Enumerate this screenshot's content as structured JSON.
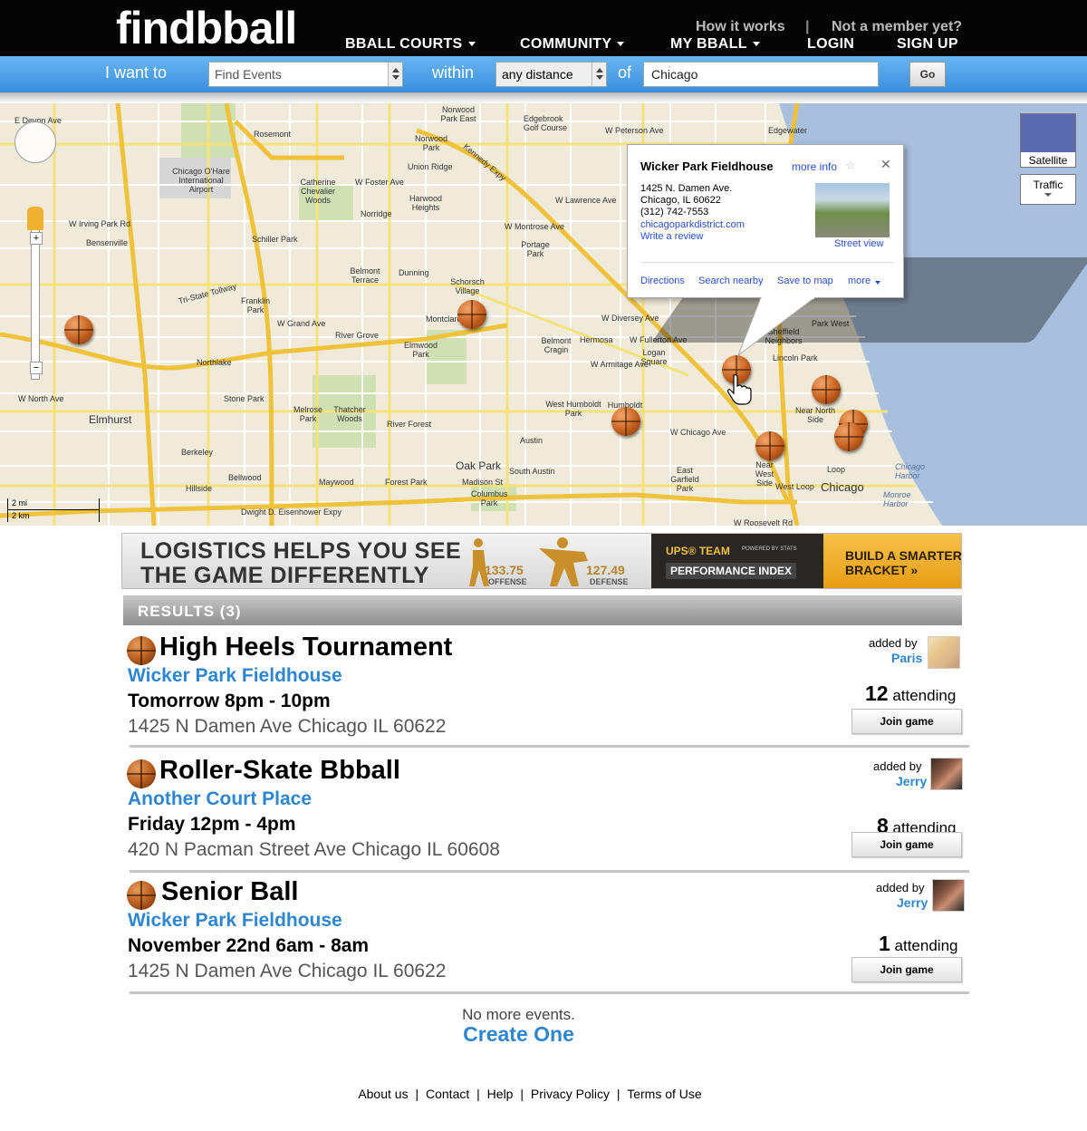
{
  "header": {
    "logo_text": "findbball",
    "how_it_works": "How it works",
    "separator": "|",
    "not_member": "Not a member yet?",
    "nav": [
      {
        "label": "BBALL COURTS"
      },
      {
        "label": "COMMUNITY"
      },
      {
        "label": "MY BBALL"
      }
    ],
    "login": "LOGIN",
    "signup": "SIGN UP"
  },
  "search": {
    "i_want_to": "I want to",
    "action_value": "Find Events",
    "within": "within",
    "distance_value": "any distance",
    "of": "of",
    "location_value": "Chicago",
    "go_label": "Go"
  },
  "map": {
    "maptype": {
      "satellite": "Satellite",
      "traffic": "Traffic"
    },
    "scale": {
      "mi": "2 mi",
      "km": "2 km"
    },
    "labels": [
      "E Devon Ave",
      "Rosemont",
      "Norridge",
      "Harwood Heights",
      "Norwood Park East",
      "Norwood Park",
      "Edgebrook Golf Course",
      "W Peterson Ave",
      "Edgewater",
      "Union Ridge",
      "Chicago O'Hare International Airport",
      "Schiller Park",
      "Bensenville",
      "Franklin Park",
      "Belmont Terrace",
      "Dunning",
      "Schorsch Village",
      "Montclare",
      "Portage Park",
      "Elmwood Park",
      "River Grove",
      "Belmont Cragin",
      "Hermosa",
      "Logan Square",
      "Sheffield Neighbors",
      "Lincoln Park",
      "Park West",
      "Northlake",
      "Stone Park",
      "Melrose Park",
      "Elmhurst",
      "Humboldt Park",
      "West Humboldt Park",
      "River Forest",
      "Oak Park",
      "Austin",
      "Near North Side",
      "Berkeley",
      "Bellwood",
      "Maywood",
      "Forest Park",
      "South Austin",
      "East Garfield Park",
      "Near West Side",
      "Loop",
      "West Loop",
      "Chicago",
      "Hillside",
      "Columbus Park",
      "Madison St",
      "Chicago Harbor",
      "Monroe Harbor",
      "Catherine Chevalier Woods",
      "Thatcher Woods",
      "Kennedy Expy",
      "Tri-State Tollway",
      "Dwight D. Eisenhower Expy",
      "W Roosevelt Rd",
      "W Chicago Ave",
      "W North Ave",
      "W Grand Ave",
      "W Irving Park Rd",
      "W Foster Ave",
      "W Lawrence Ave",
      "W Montrose Ave",
      "W Diversey Ave",
      "W Fullerton Ave",
      "W Armitage Ave"
    ],
    "infowindow": {
      "title": "Wicker Park Fieldhouse",
      "more_info": "more info",
      "address1": "1425 N. Damen Ave.",
      "address2": "Chicago, IL 60622",
      "phone": "(312) 742-7553",
      "website": "chicagoparkdistrict.com",
      "review": "Write a review",
      "street_view": "Street view",
      "actions": [
        "Directions",
        "Search nearby",
        "Save to map",
        "more"
      ]
    }
  },
  "ad": {
    "line1": "LOGISTICS HELPS YOU SEE",
    "line2": "THE GAME DIFFERENTLY",
    "stat1_value": "133.75",
    "stat1_label": "OFFENSE",
    "stat2_value": "127.49",
    "stat2_label": "DEFENSE",
    "brand1": "UPS® TEAM",
    "brand2": "PERFORMANCE INDEX",
    "powered": "POWERED BY STATS",
    "cta1": "BUILD A SMARTER",
    "cta2": "BRACKET »"
  },
  "results": {
    "header": "RESULTS (3)",
    "events": [
      {
        "title": "High Heels Tournament",
        "court": "Wicker Park Fieldhouse",
        "when": "Tomorrow 8pm - 10pm",
        "address": "1425 N Damen Ave Chicago IL 60622",
        "added_by": "added by",
        "user": "Paris",
        "attending_count": "12",
        "attending_label": "attending",
        "join": "Join game"
      },
      {
        "title": "Roller-Skate Bbball",
        "court": "Another Court Place",
        "when": "Friday 12pm - 4pm",
        "address": "420 N  Pacman Street Ave Chicago IL 60608",
        "added_by": "added by",
        "user": "Jerry",
        "attending_count": "8",
        "attending_label": "attending",
        "join": "Join game"
      },
      {
        "title": "Senior Ball",
        "court": "Wicker Park Fieldhouse",
        "when": "November 22nd 6am - 8am",
        "address": "1425 N Damen Ave Chicago IL 60622",
        "added_by": "added by",
        "user": "Jerry",
        "attending_count": "1",
        "attending_label": "attending",
        "join": "Join game"
      }
    ],
    "no_more": "No more events.",
    "create_one": "Create One"
  },
  "footer": {
    "links": [
      "About us",
      "Contact",
      "Help",
      "Privacy Policy",
      "Terms of Use"
    ],
    "separator": "|"
  },
  "colors": {
    "topbar": "#050505",
    "searchbar": "#4a9ee8",
    "accent_blue": "#2f86cf",
    "logo_orange": "#f7941d",
    "water": "#a9bfde",
    "highway": "#f6cf44"
  }
}
